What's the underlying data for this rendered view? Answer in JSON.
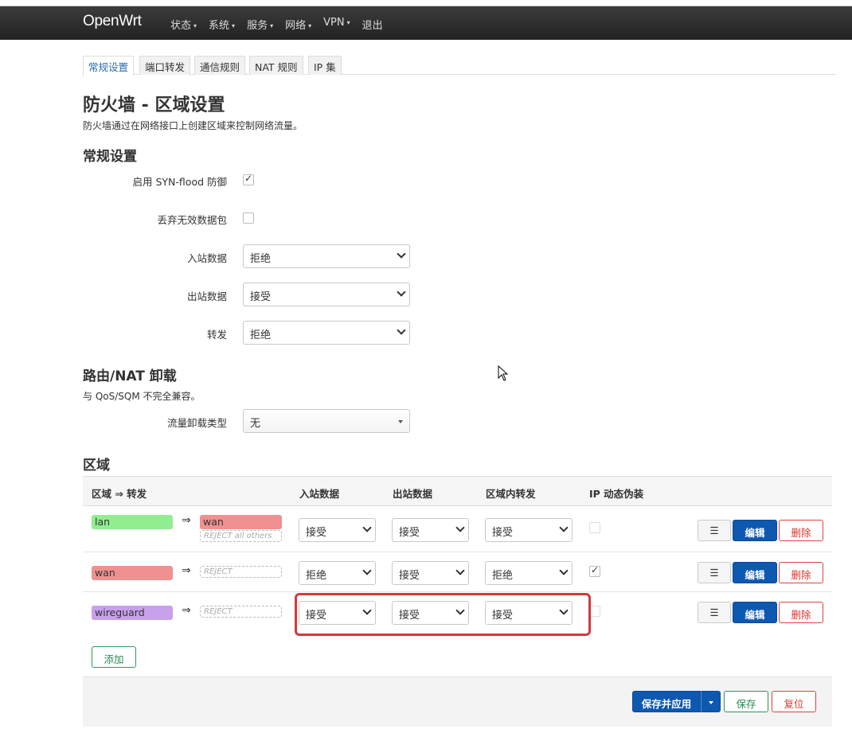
{
  "brand": "OpenWrt",
  "menu": [
    "状态",
    "系统",
    "服务",
    "网络",
    "VPN"
  ],
  "menu_logout": "退出",
  "tabs": [
    "常规设置",
    "端口转发",
    "通信规则",
    "NAT 规则",
    "IP 集"
  ],
  "page_title": "防火墙 - 区域设置",
  "page_desc": "防火墙通过在网络接口上创建区域来控制网络流量。",
  "general": {
    "title": "常规设置",
    "synflood_label": "启用 SYN-flood 防御",
    "synflood_checked": true,
    "drop_invalid_label": "丢弃无效数据包",
    "drop_invalid_checked": false,
    "input_label": "入站数据",
    "input_value": "拒绝",
    "output_label": "出站数据",
    "output_value": "接受",
    "forward_label": "转发",
    "forward_value": "拒绝"
  },
  "offload": {
    "title": "路由/NAT 卸载",
    "desc": "与 QoS/SQM 不完全兼容。",
    "type_label": "流量卸载类型",
    "type_value": "无"
  },
  "zones": {
    "title": "区域",
    "headers": [
      "区域 ⇒ 转发",
      "入站数据",
      "出站数据",
      "区域内转发",
      "IP 动态伪装"
    ],
    "arrow": "⇒",
    "rows": [
      {
        "name": "lan",
        "color": "#90ee90",
        "dest": "wan",
        "dest_color": "#f09090",
        "dest_note": "REJECT all others",
        "input": "接受",
        "output": "接受",
        "forward": "接受",
        "masq": false
      },
      {
        "name": "wan",
        "color": "#f09090",
        "dest": "REJECT",
        "input": "拒绝",
        "output": "接受",
        "forward": "拒绝",
        "masq": true
      },
      {
        "name": "wireguard",
        "color": "#c8a0ec",
        "dest": "REJECT",
        "input": "接受",
        "output": "接受",
        "forward": "接受",
        "masq": false
      }
    ],
    "menu_btn": "☰",
    "edit_btn": "编辑",
    "delete_btn": "删除",
    "add_btn": "添加"
  },
  "footer": {
    "save_apply": "保存并应用",
    "save": "保存",
    "reset": "复位"
  }
}
